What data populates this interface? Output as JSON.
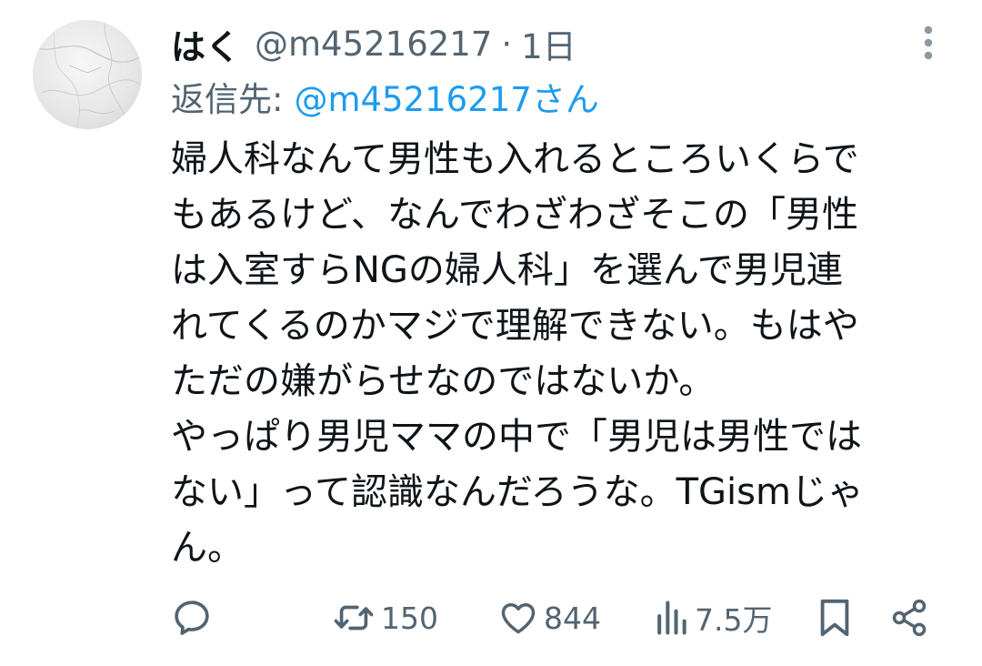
{
  "tweet": {
    "display_name": "はく",
    "handle": "@m45216217",
    "separator": "·",
    "time": "1日",
    "reply_label": "返信先:",
    "reply_handle": "@m45216217さん",
    "body_lines": [
      "婦人科なんて男性も入れるところいくらで",
      "もあるけど、なんでわざわざそこの「男性",
      "は入室すらNGの婦人科」を選んで男児連",
      "れてくるのかマジで理解できない。もはや",
      "ただの嫌がらせなのではないか。",
      "やっぱり男児ママの中で「男児は男性では",
      "ない」って認識なんだろうな。TGismじゃ",
      "ん。"
    ]
  },
  "actions": {
    "reply": {
      "icon": "reply-icon"
    },
    "retweet": {
      "icon": "retweet-icon",
      "count": "150"
    },
    "like": {
      "icon": "heart-icon",
      "count": "844"
    },
    "views": {
      "icon": "bar-chart-icon",
      "count": "7.5万"
    },
    "bookmark": {
      "icon": "bookmark-icon"
    },
    "share": {
      "icon": "share-icon"
    }
  },
  "colors": {
    "text": "#0f1419",
    "secondary": "#536471",
    "link": "#1d9bf0",
    "background": "#ffffff"
  }
}
